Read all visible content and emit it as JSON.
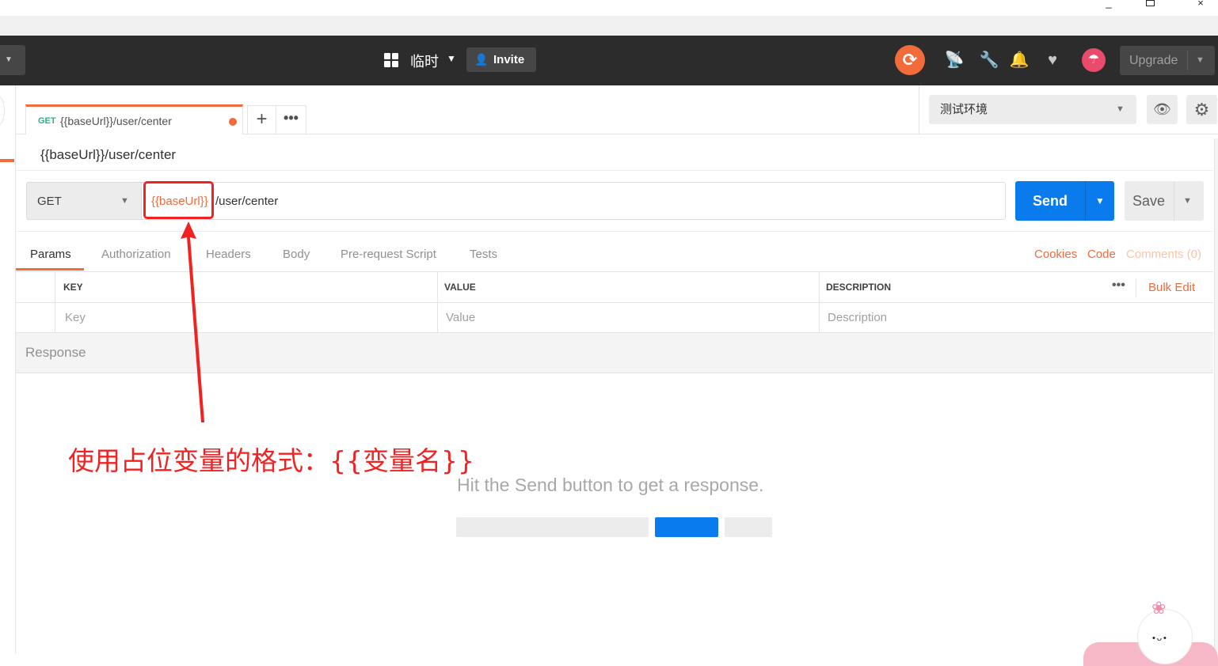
{
  "header": {
    "workspace_name": "临时",
    "invite_label": "Invite",
    "upgrade_label": "Upgrade",
    "icons": [
      "workspace-grid-icon",
      "sync-icon",
      "satellite-icon",
      "wrench-icon",
      "bell-icon",
      "heart-icon",
      "avatar-icon"
    ]
  },
  "tabs": [
    {
      "method": "GET",
      "title": "{{baseUrl}}/user/center",
      "unsaved": true
    }
  ],
  "environment": {
    "selected": "测试环境"
  },
  "request": {
    "name": "{{baseUrl}}/user/center",
    "method": "GET",
    "url_variable": "{{baseUrl}}",
    "url_path": "/user/center",
    "send_label": "Send",
    "save_label": "Save"
  },
  "subtabs": [
    "Params",
    "Authorization",
    "Headers",
    "Body",
    "Pre-request Script",
    "Tests"
  ],
  "right_links": {
    "cookies": "Cookies",
    "code": "Code",
    "comments": "Comments (0)"
  },
  "params_table": {
    "headers": [
      "KEY",
      "VALUE",
      "DESCRIPTION"
    ],
    "placeholders": [
      "Key",
      "Value",
      "Description"
    ],
    "bulk_edit": "Bulk Edit"
  },
  "response": {
    "label": "Response",
    "empty_message": "Hit the Send button to get a response."
  },
  "annotation": {
    "text": "使用占位变量的格式：{{变量名}}",
    "color": "#f22222"
  },
  "colors": {
    "accent": "#f26b3a",
    "send": "#097bed",
    "header_bg": "#2c2c2c",
    "method_get": "#26b47f"
  }
}
